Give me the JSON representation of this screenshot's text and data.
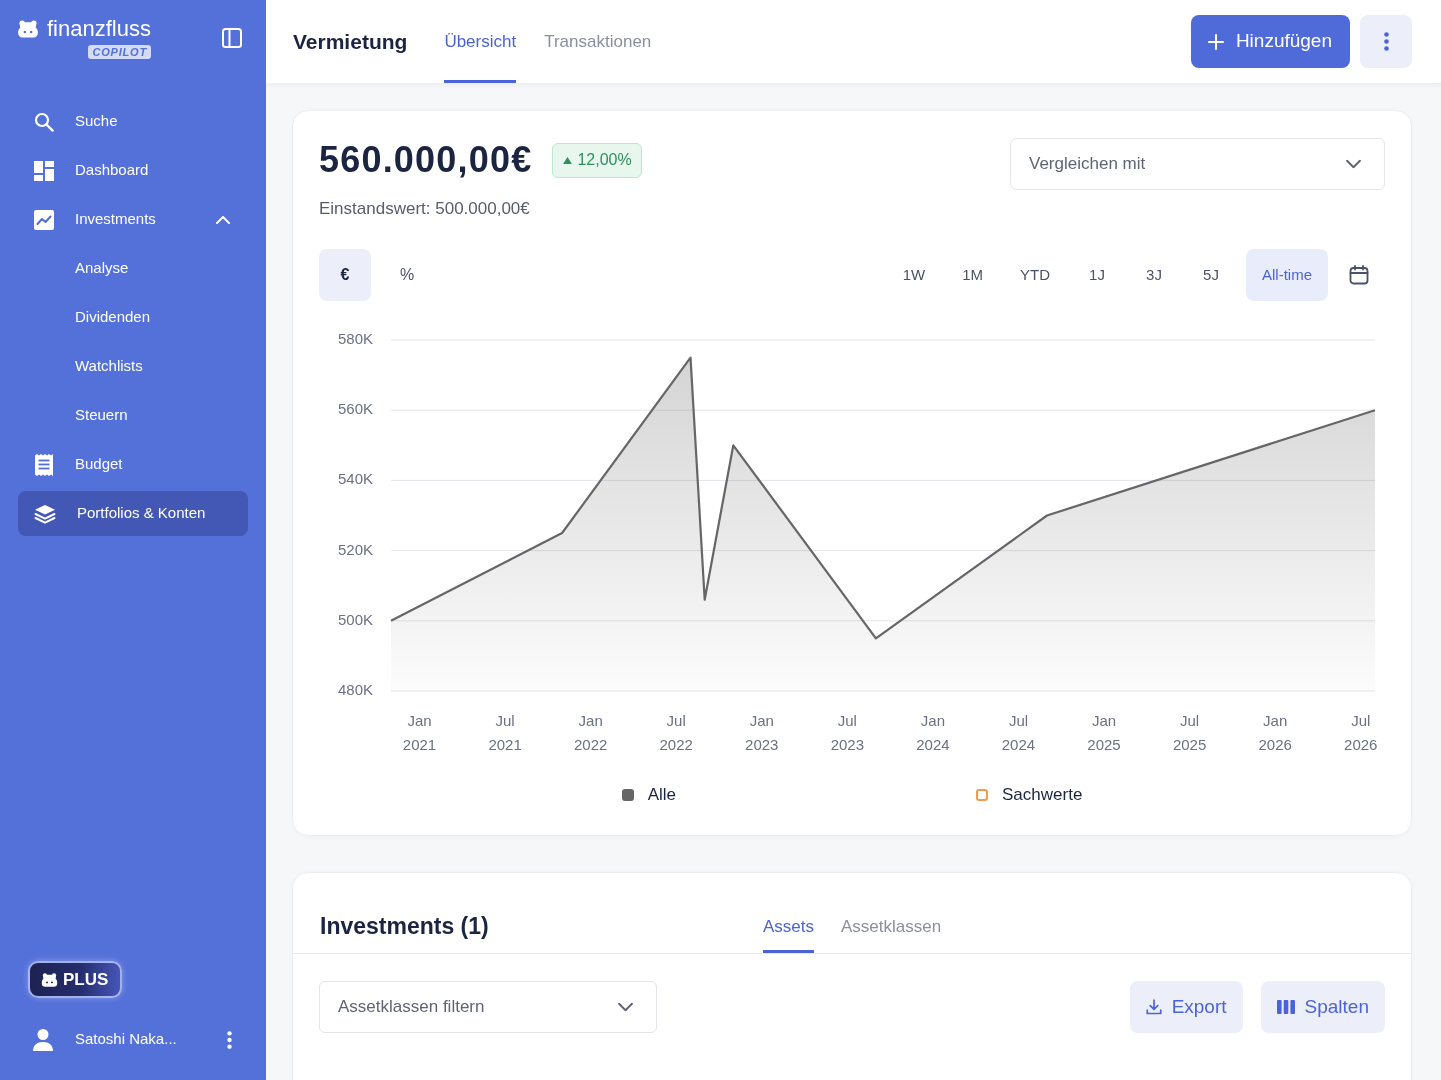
{
  "sidebar": {
    "logo": {
      "name": "finanzfluss",
      "badge": "COPILOT"
    },
    "items": [
      {
        "label": "Suche",
        "selected": false
      },
      {
        "label": "Dashboard",
        "selected": false
      },
      {
        "label": "Investments",
        "selected": false,
        "expanded": true,
        "children": [
          {
            "label": "Analyse",
            "selected": false
          },
          {
            "label": "Dividenden",
            "selected": false
          },
          {
            "label": "Watchlists",
            "selected": false
          },
          {
            "label": "Steuern",
            "selected": false
          }
        ]
      },
      {
        "label": "Budget",
        "selected": false
      },
      {
        "label": "Portfolios & Konten",
        "selected": true
      }
    ],
    "plan_badge": "PLUS",
    "user": {
      "name": "Satoshi Naka..."
    }
  },
  "header": {
    "title": "Vermietung",
    "tabs": [
      {
        "label": "Übersicht",
        "selected": true
      },
      {
        "label": "Transaktionen",
        "selected": false
      }
    ],
    "add_button": "Hinzufügen"
  },
  "value_card": {
    "value": "560.000,00€",
    "change": {
      "text": "12,00%",
      "rising": true
    },
    "cost_basis": "Einstandswert: 500.000,00€",
    "compare_select": {
      "placeholder": "Vergleichen mit"
    },
    "units": [
      {
        "label": "€",
        "selected": true
      },
      {
        "label": "%",
        "selected": false
      }
    ],
    "ranges": [
      {
        "label": "1W",
        "selected": false
      },
      {
        "label": "1M",
        "selected": false
      },
      {
        "label": "YTD",
        "selected": false
      },
      {
        "label": "1J",
        "selected": false
      },
      {
        "label": "3J",
        "selected": false
      },
      {
        "label": "5J",
        "selected": false
      },
      {
        "label": "All-time",
        "selected": true
      }
    ],
    "chart_data": {
      "type": "area",
      "grid": true,
      "categories": [
        null,
        null,
        "Jan 2021",
        null,
        null,
        null,
        null,
        null,
        "Jul 2021",
        null,
        null,
        null,
        null,
        null,
        "Jan 2022",
        null,
        null,
        null,
        null,
        null,
        "Jul 2022",
        null,
        null,
        null,
        null,
        null,
        "Jan 2023",
        null,
        null,
        null,
        null,
        null,
        "Jul 2023",
        null,
        null,
        null,
        null,
        null,
        "Jan 2024",
        null,
        null,
        null,
        null,
        null,
        "Jul 2024",
        null,
        null,
        null,
        null,
        null,
        "Jan 2025",
        null,
        null,
        null,
        null,
        null,
        "Jul 2025",
        null,
        null,
        null,
        null,
        null,
        "Jan 2026",
        null,
        null,
        null,
        null,
        null,
        "Jul 2026",
        null
      ],
      "series": [
        {
          "name": "Alle",
          "color": "#666666",
          "values": [
            500000,
            null,
            null,
            null,
            null,
            null,
            null,
            null,
            null,
            null,
            null,
            null,
            525000,
            null,
            null,
            null,
            null,
            null,
            null,
            null,
            null,
            575000,
            506000,
            null,
            550000,
            null,
            null,
            null,
            null,
            null,
            null,
            null,
            null,
            null,
            495000,
            null,
            null,
            null,
            null,
            null,
            null,
            null,
            null,
            null,
            null,
            null,
            530000,
            null,
            null,
            null,
            null,
            null,
            null,
            null,
            null,
            null,
            null,
            null,
            null,
            null,
            null,
            null,
            null,
            null,
            null,
            null,
            null,
            null,
            null,
            560000
          ]
        }
      ],
      "ylim": [
        480000,
        580000
      ],
      "yticks": [
        {
          "value": 480000,
          "label": "480K"
        },
        {
          "value": 500000,
          "label": "500K"
        },
        {
          "value": 520000,
          "label": "520K"
        },
        {
          "value": 540000,
          "label": "540K"
        },
        {
          "value": 560000,
          "label": "560K"
        },
        {
          "value": 580000,
          "label": "580K"
        }
      ]
    },
    "hidden_series": [
      {
        "name": "Sachwerte",
        "color": "#f29b4c"
      }
    ]
  },
  "investments_card": {
    "title": "Investments (1)",
    "tabs": [
      {
        "label": "Assets",
        "selected": true
      },
      {
        "label": "Assetklassen",
        "selected": false
      }
    ],
    "filter_select": {
      "placeholder": "Assetklassen filtern"
    },
    "buttons": [
      "Export",
      "Spalten"
    ]
  }
}
